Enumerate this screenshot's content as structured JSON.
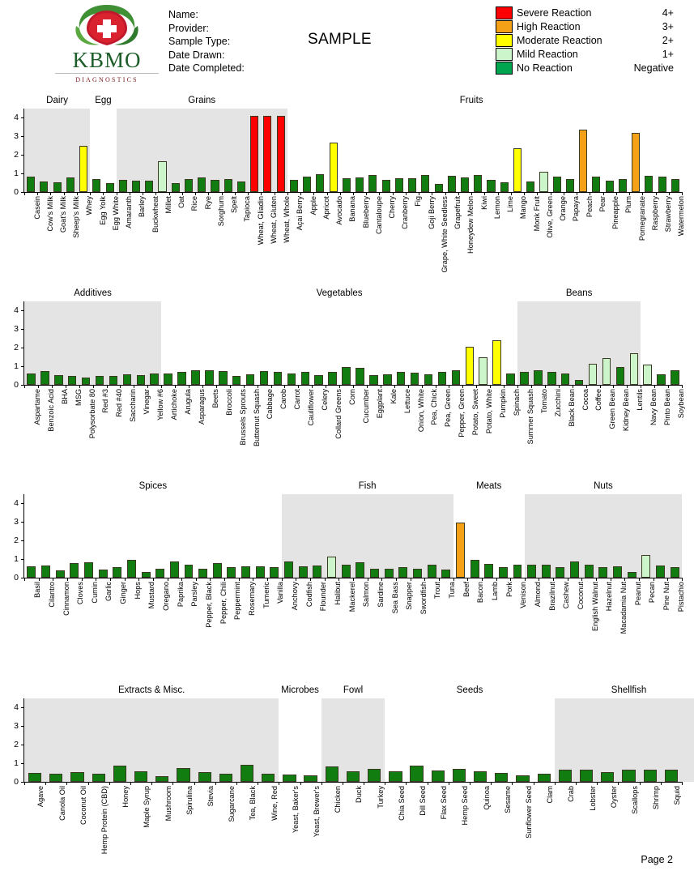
{
  "brand": {
    "name": "KBMO",
    "sub": "DIAGNOSTICS",
    "logo_icon": "leaf-shield-cross-logo"
  },
  "patient": {
    "name_label": "Name:",
    "provider_label": "Provider:",
    "sample_type_label": "Sample Type:",
    "date_drawn_label": "Date Drawn:",
    "date_completed_label": "Date Completed:"
  },
  "watermark": "SAMPLE",
  "footer": {
    "page": "Page 2"
  },
  "legend": {
    "items": [
      {
        "label": "Severe Reaction",
        "score": "4+",
        "color": "#fe0000"
      },
      {
        "label": "High Reaction",
        "score": "3+",
        "color": "#f5a117"
      },
      {
        "label": "Moderate Reaction",
        "score": "2+",
        "color": "#ffff00"
      },
      {
        "label": "Mild Reaction",
        "score": "1+",
        "color": "#ccf5cc"
      },
      {
        "label": "No Reaction",
        "score": "Negative",
        "color": "#00a54f"
      }
    ]
  },
  "palette": {
    "severe": "#fe0000",
    "high": "#f5a117",
    "moderate": "#ffff00",
    "mild": "#ccf5cc",
    "none": "#117d11",
    "band": "#e4e4e4"
  },
  "axis": {
    "ticks": [
      0,
      1,
      2,
      3,
      4
    ],
    "ymax": 4.5
  },
  "chart_data": [
    {
      "type": "bar",
      "title": "",
      "ylabel": "",
      "ylim": [
        0,
        4.5
      ],
      "groups": [
        {
          "name": "Dairy",
          "shaded": true,
          "start": 0,
          "end": 5
        },
        {
          "name": "Egg",
          "shaded": false,
          "start": 5,
          "end": 7
        },
        {
          "name": "Grains",
          "shaded": true,
          "start": 7,
          "end": 20
        },
        {
          "name": "Fruits",
          "shaded": false,
          "start": 20,
          "end": 48
        }
      ],
      "categories": [
        "Casein",
        "Cow's Milk",
        "Goat's Milk",
        "Sheep's Milk",
        "Whey",
        "Egg Yolk",
        "Egg White",
        "Amaranth",
        "Barley",
        "Buckwheat",
        "Millet",
        "Oat",
        "Rice",
        "Rye",
        "Sorghum",
        "Spelt",
        "Tapioca",
        "Wheat, Gliadin",
        "Wheat, Gluten",
        "Wheat, Whole",
        "Açai Berry",
        "Apple",
        "Apricot",
        "Avocado",
        "Banana",
        "Blueberry",
        "Cantaloupe",
        "Cherry",
        "Cranberry",
        "Fig",
        "Goji Berry",
        "Grape, White Seedless",
        "Grapefruit",
        "Honeydew Melon",
        "Kiwi",
        "Lemon",
        "Lime",
        "Mango",
        "Monk Fruit",
        "Olive, Green",
        "Orange",
        "Papaya",
        "Peach",
        "Pear",
        "Pineapple",
        "Plum",
        "Pomegranate",
        "Raspberry",
        "Strawberry",
        "Watermelon"
      ],
      "values": [
        0.85,
        0.56,
        0.53,
        0.78,
        2.5,
        0.7,
        0.48,
        0.65,
        0.62,
        0.62,
        1.65,
        0.49,
        0.72,
        0.79,
        0.67,
        0.69,
        0.59,
        4.1,
        4.1,
        4.1,
        0.66,
        0.82,
        0.96,
        2.66,
        0.76,
        0.78,
        0.92,
        0.66,
        0.74,
        0.76,
        0.91,
        0.42,
        0.88,
        0.8,
        0.92,
        0.67,
        0.52,
        2.36,
        0.59,
        1.08,
        0.84,
        0.7,
        3.37,
        0.83,
        0.62,
        0.68,
        3.18,
        0.87,
        0.82,
        0.72
      ]
    },
    {
      "type": "bar",
      "title": "",
      "ylabel": "",
      "ylim": [
        0,
        4.5
      ],
      "groups": [
        {
          "name": "Additives",
          "shaded": true,
          "start": 0,
          "end": 10
        },
        {
          "name": "Vegetables",
          "shaded": false,
          "start": 10,
          "end": 36
        },
        {
          "name": "Beans",
          "shaded": true,
          "start": 36,
          "end": 45
        }
      ],
      "categories": [
        "Aspartame",
        "Benzoic Acid",
        "BHA",
        "MSG",
        "Polysorbate 80",
        "Red #3",
        "Red #40",
        "Saccharin",
        "Vinegar",
        "Yellow #6",
        "Artichoke",
        "Arugula",
        "Asparagus",
        "Beets",
        "Broccoli",
        "Brussels Sprouts",
        "Butternut Squash",
        "Cabbage",
        "Carob",
        "Carrot",
        "Cauliflower",
        "Celery",
        "Collard Greens",
        "Corn",
        "Cucumber",
        "Eggplant",
        "Kale",
        "Lettuce",
        "Onion, White",
        "Pea, Chick",
        "Pea, Green",
        "Pepper, Green",
        "Potato, Sweet",
        "Potato, White",
        "Pumpkin",
        "Spinach",
        "Summer Squash",
        "Tomato",
        "Zucchini",
        "Black Bean",
        "Cocoa",
        "Coffee",
        "Green Bean",
        "Kidney Bean",
        "Lentils",
        "Navy Bean",
        "Pinto Bean",
        "Soybean"
      ],
      "values": [
        0.62,
        0.75,
        0.52,
        0.47,
        0.38,
        0.46,
        0.47,
        0.59,
        0.54,
        0.61,
        0.62,
        0.72,
        0.79,
        0.77,
        0.74,
        0.49,
        0.56,
        0.73,
        0.72,
        0.62,
        0.68,
        0.54,
        0.72,
        0.97,
        0.93,
        0.53,
        0.57,
        0.7,
        0.65,
        0.57,
        0.71,
        0.78,
        2.05,
        1.5,
        2.4,
        0.61,
        0.72,
        0.8,
        0.69,
        0.62,
        0.26,
        1.12,
        1.43,
        0.96,
        1.7,
        1.1,
        0.55,
        0.78
      ]
    },
    {
      "type": "bar",
      "title": "",
      "ylabel": "",
      "ylim": [
        0,
        4.5
      ],
      "groups": [
        {
          "name": "Spices",
          "shaded": false,
          "start": 0,
          "end": 18
        },
        {
          "name": "Fish",
          "shaded": true,
          "start": 18,
          "end": 30
        },
        {
          "name": "Meats",
          "shaded": false,
          "start": 30,
          "end": 35
        },
        {
          "name": "Nuts",
          "shaded": true,
          "start": 35,
          "end": 46
        }
      ],
      "categories": [
        "Basil",
        "Cilantro",
        "Cinnamon",
        "Cloves",
        "Cumin",
        "Garlic",
        "Ginger",
        "Hops",
        "Mustard",
        "Oregano",
        "Paprika",
        "Parsley",
        "Pepper, Black",
        "Pepper, Chili",
        "Peppermint",
        "Rosemary",
        "Tumeric",
        "Vanilla",
        "Anchovy",
        "Codfish",
        "Flounder",
        "Halibut",
        "Mackerel",
        "Salmon",
        "Sardine",
        "Sea Bass",
        "Snapper",
        "Swordfish",
        "Trout",
        "Tuna",
        "Beef",
        "Bacon",
        "Lamb",
        "Pork",
        "Venison",
        "Almond",
        "Brazilnut",
        "Cashew",
        "Coconut",
        "English Walnut",
        "Hazelnut",
        "Macadamia Nut",
        "Peanut",
        "Pecan",
        "Pine Nut",
        "Pistachio"
      ],
      "values": [
        0.63,
        0.64,
        0.41,
        0.79,
        0.81,
        0.45,
        0.56,
        0.98,
        0.32,
        0.49,
        0.87,
        0.69,
        0.47,
        0.78,
        0.58,
        0.6,
        0.6,
        0.57,
        0.86,
        0.6,
        0.64,
        1.12,
        0.7,
        0.85,
        0.47,
        0.49,
        0.55,
        0.47,
        0.72,
        0.44,
        2.95,
        0.98,
        0.75,
        0.57,
        0.7,
        0.68,
        0.7,
        0.58,
        0.88,
        0.68,
        0.55,
        0.6,
        0.32,
        1.23,
        0.66,
        0.57
      ]
    },
    {
      "type": "bar",
      "title": "",
      "ylabel": "",
      "ylim": [
        0,
        4.5
      ],
      "groups": [
        {
          "name": "Extracts & Misc.",
          "shaded": true,
          "start": 0,
          "end": 12
        },
        {
          "name": "Microbes",
          "shaded": false,
          "start": 12,
          "end": 14
        },
        {
          "name": "Fowl",
          "shaded": true,
          "start": 14,
          "end": 17
        },
        {
          "name": "Seeds",
          "shaded": false,
          "start": 17,
          "end": 25
        },
        {
          "name": "Shellfish",
          "shaded": true,
          "start": 25,
          "end": 32
        }
      ],
      "categories": [
        "Agave",
        "Canola Oil",
        "Coconut Oil",
        "Hemp Protein (CBD)",
        "Honey",
        "Maple Syrup",
        "Mushroom",
        "Spirulina",
        "Stevia",
        "Sugarcane",
        "Tea, Black",
        "Wine, Red",
        "Yeast, Baker's",
        "Yeast, Brewer's",
        "Chicken",
        "Duck",
        "Turkey",
        "Chia Seed",
        "Dill Seed",
        "Flax Seed",
        "Hemp Seed",
        "Quinoa",
        "Sesame",
        "Sunflower Seed",
        "Clam",
        "Crab",
        "Lobster",
        "Oyster",
        "Scallops",
        "Shrimp",
        "Squid"
      ],
      "values": [
        0.49,
        0.45,
        0.53,
        0.44,
        0.87,
        0.58,
        0.32,
        0.76,
        0.53,
        0.45,
        0.94,
        0.42,
        0.38,
        0.37,
        0.85,
        0.57,
        0.69,
        0.56,
        0.88,
        0.62,
        0.68,
        0.56,
        0.49,
        0.35,
        0.45,
        0.66,
        0.64,
        0.53,
        0.67,
        0.66,
        0.67
      ]
    }
  ]
}
